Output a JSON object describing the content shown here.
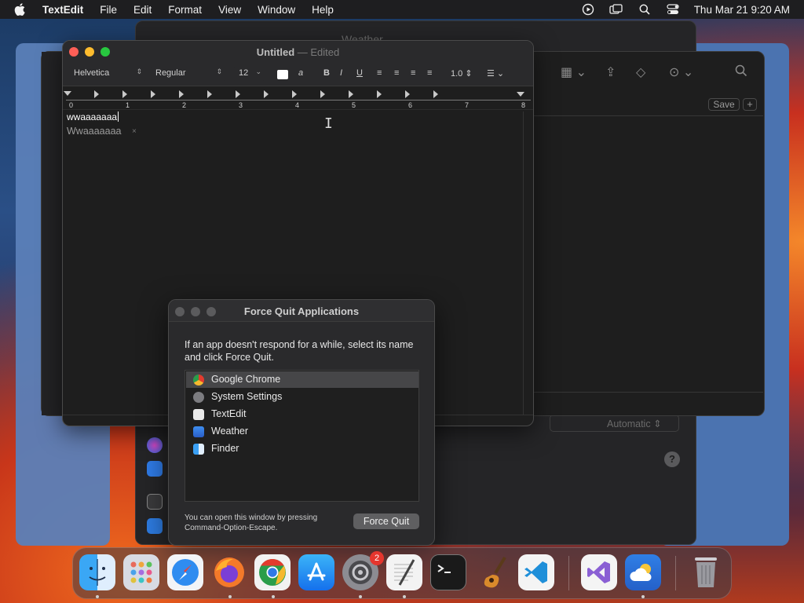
{
  "menubar": {
    "app_name": "TextEdit",
    "items": [
      "File",
      "Edit",
      "Format",
      "View",
      "Window",
      "Help"
    ],
    "clock": "Thu Mar 21  9:20 AM",
    "icons": [
      "apple-icon",
      "screen-recording-icon",
      "screen-mirroring-icon",
      "spotlight-search-icon",
      "control-center-icon"
    ]
  },
  "weather_window": {
    "title": "Weather",
    "select_value": "Automatic",
    "help_label": "?"
  },
  "notes_window": {
    "save_label": "Save",
    "plus_label": "+"
  },
  "textedit": {
    "title": "Untitled",
    "separator": " — ",
    "edited": "Edited",
    "font_family": "Helvetica",
    "font_style": "Regular",
    "font_size": "12",
    "bold_label": "B",
    "italic_label": "I",
    "underline_label": "U",
    "line_spacing": "1.0",
    "ruler_numbers": [
      "0",
      "1",
      "2",
      "3",
      "4",
      "5",
      "6",
      "7",
      "8"
    ],
    "document_text": "wwaaaaaaa",
    "suggestion": "Wwaaaaaaa",
    "suggestion_close": "×"
  },
  "force_quit": {
    "title": "Force Quit Applications",
    "message": "If an app doesn't respond for a while, select its name and click Force Quit.",
    "apps": [
      {
        "name": "Google Chrome",
        "selected": true
      },
      {
        "name": "System Settings",
        "selected": false
      },
      {
        "name": "TextEdit",
        "selected": false
      },
      {
        "name": "Weather",
        "selected": false
      },
      {
        "name": "Finder",
        "selected": false
      }
    ],
    "footnote_line1": "You can open this window by pressing",
    "footnote_line2": "Command-Option-Escape.",
    "button_label": "Force Quit"
  },
  "dock": {
    "apps": [
      "Finder",
      "Launchpad",
      "Safari",
      "Firefox",
      "Google Chrome",
      "App Store",
      "System Settings",
      "TextEdit",
      "Terminal",
      "GarageBand",
      "Visual Studio Code",
      "Visual Studio",
      "Weather",
      "Trash"
    ],
    "system_settings_badge": "2"
  },
  "colors": {
    "traffic_red": "#fe5f57",
    "traffic_yellow": "#febc2e",
    "traffic_green": "#28c840",
    "badge_red": "#e5362e"
  }
}
